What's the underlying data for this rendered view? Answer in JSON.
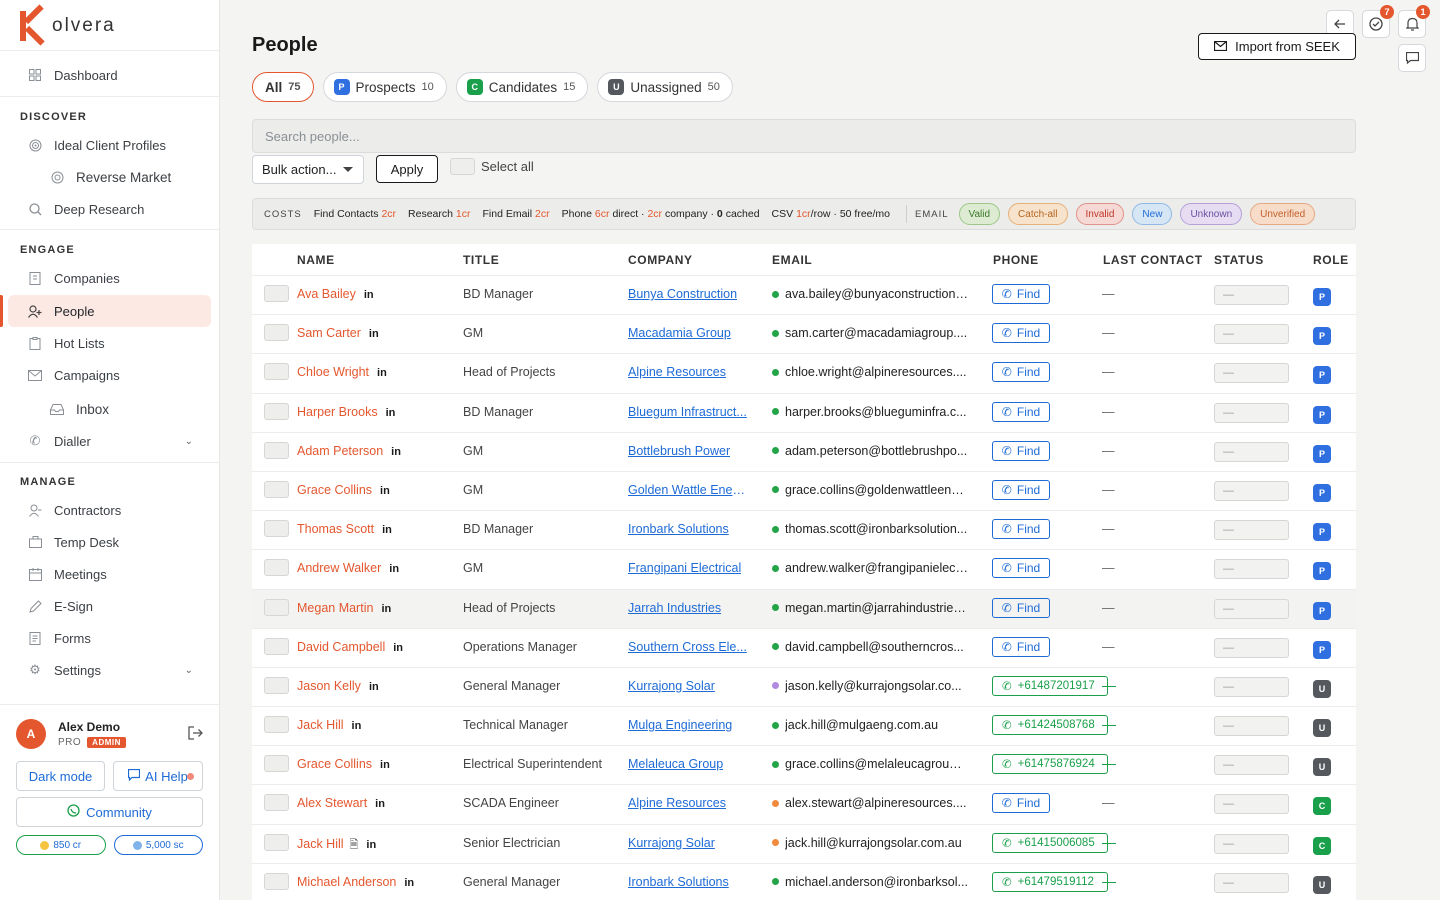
{
  "brand": {
    "name": "olvera",
    "accent": "#e4572e"
  },
  "nav": {
    "dashboard": "Dashboard",
    "discover_label": "DISCOVER",
    "ideal_client": "Ideal Client Profiles",
    "reverse_market": "Reverse Market",
    "deep_research": "Deep Research",
    "engage_label": "ENGAGE",
    "companies": "Companies",
    "people": "People",
    "hot_lists": "Hot Lists",
    "campaigns": "Campaigns",
    "inbox": "Inbox",
    "dialler": "Dialler",
    "manage_label": "MANAGE",
    "contractors": "Contractors",
    "temp_desk": "Temp Desk",
    "meetings": "Meetings",
    "esign": "E-Sign",
    "forms": "Forms",
    "settings": "Settings"
  },
  "user": {
    "initial": "A",
    "name": "Alex Demo",
    "tier": "PRO",
    "role_badge": "ADMIN",
    "dark_mode": "Dark mode",
    "ai_help": "AI Help",
    "community": "Community",
    "credits": "850 cr",
    "sc": "5,000 sc"
  },
  "header": {
    "title": "People",
    "import_btn": "Import from SEEK",
    "tasks_count": "7",
    "notif_count": "1"
  },
  "tabs": [
    {
      "label": "All",
      "count": "75"
    },
    {
      "badge": "P",
      "label": "Prospects",
      "count": "10"
    },
    {
      "badge": "C",
      "label": "Candidates",
      "count": "15"
    },
    {
      "badge": "U",
      "label": "Unassigned",
      "count": "50"
    }
  ],
  "toolbar": {
    "search_placeholder": "Search people...",
    "bulk": "Bulk action...",
    "apply": "Apply",
    "select_all": "Select all"
  },
  "costs": {
    "label": "COSTS",
    "find_contacts": "Find Contacts",
    "find_contacts_cr": "2cr",
    "research": "Research",
    "research_cr": "1cr",
    "find_email": "Find Email",
    "find_email_cr": "2cr",
    "phone": "Phone",
    "phone_direct_cr": "6cr",
    "phone_direct": "direct ·",
    "phone_company_cr": "2cr",
    "phone_company": "company ·",
    "phone_cached_cr": "0",
    "phone_cached": "cached",
    "csv": "CSV",
    "csv_cr": "1cr",
    "csv_rest": "/row · 50 free/mo",
    "email_label": "EMAIL",
    "pills": [
      {
        "label": "Valid",
        "color": "#3d7a2a",
        "bg": "#dcebd2",
        "border": "#9cc788"
      },
      {
        "label": "Catch-all",
        "color": "#b5651d",
        "bg": "#f7e3cc",
        "border": "#e5b079"
      },
      {
        "label": "Invalid",
        "color": "#c0392b",
        "bg": "#f6d8d4",
        "border": "#e0928a"
      },
      {
        "label": "New",
        "color": "#1e6bd6",
        "bg": "#d6e6f5",
        "border": "#8fb9e4"
      },
      {
        "label": "Unknown",
        "color": "#6b4fa0",
        "bg": "#e6ddf3",
        "border": "#b6a0d8"
      },
      {
        "label": "Unverified",
        "color": "#c0602b",
        "bg": "#f7dcc9",
        "border": "#e6a883"
      }
    ]
  },
  "table": {
    "columns": [
      "NAME",
      "TITLE",
      "COMPANY",
      "EMAIL",
      "PHONE",
      "LAST CONTACT",
      "STATUS",
      "ROLE"
    ],
    "find_label": "Find",
    "dash": "—",
    "li": "in",
    "rows": [
      {
        "name": "Ava Bailey",
        "title": "BD Manager",
        "company": "Bunya Construction",
        "email": "ava.bailey@bunyaconstruction....",
        "email_status": "#22a447",
        "phone": "",
        "role": "P"
      },
      {
        "name": "Sam Carter",
        "title": "GM",
        "company": "Macadamia Group",
        "email": "sam.carter@macadamiagroup....",
        "email_status": "#22a447",
        "phone": "",
        "role": "P"
      },
      {
        "name": "Chloe Wright",
        "title": "Head of Projects",
        "company": "Alpine Resources",
        "email": "chloe.wright@alpineresources....",
        "email_status": "#22a447",
        "phone": "",
        "role": "P"
      },
      {
        "name": "Harper Brooks",
        "title": "BD Manager",
        "company": "Bluegum Infrastruct...",
        "email": "harper.brooks@blueguminfra.c...",
        "email_status": "#22a447",
        "phone": "",
        "role": "P"
      },
      {
        "name": "Adam Peterson",
        "title": "GM",
        "company": "Bottlebrush Power",
        "email": "adam.peterson@bottlebrushpo...",
        "email_status": "#22a447",
        "phone": "",
        "role": "P"
      },
      {
        "name": "Grace Collins",
        "title": "GM",
        "company": "Golden Wattle Energy",
        "email": "grace.collins@goldenwattleene...",
        "email_status": "#22a447",
        "phone": "",
        "role": "P"
      },
      {
        "name": "Thomas Scott",
        "title": "BD Manager",
        "company": "Ironbark Solutions",
        "email": "thomas.scott@ironbarksolution...",
        "email_status": "#22a447",
        "phone": "",
        "role": "P"
      },
      {
        "name": "Andrew Walker",
        "title": "GM",
        "company": "Frangipani Electrical",
        "email": "andrew.walker@frangipanielect...",
        "email_status": "#22a447",
        "phone": "",
        "role": "P"
      },
      {
        "name": "Megan Martin",
        "title": "Head of Projects",
        "company": "Jarrah Industries",
        "email": "megan.martin@jarrahindustries...",
        "email_status": "#22a447",
        "phone": "",
        "role": "P"
      },
      {
        "name": "David Campbell",
        "title": "Operations Manager",
        "company": "Southern Cross Ele...",
        "email": "david.campbell@southerncros...",
        "email_status": "#22a447",
        "phone": "",
        "role": "P"
      },
      {
        "name": "Jason Kelly",
        "title": "General Manager",
        "company": "Kurrajong Solar",
        "email": "jason.kelly@kurrajongsolar.co...",
        "email_status": "#b08ae0",
        "phone": "+61487201917",
        "role": "U"
      },
      {
        "name": "Jack Hill",
        "title": "Technical Manager",
        "company": "Mulga Engineering",
        "email": "jack.hill@mulgaeng.com.au",
        "email_status": "#22a447",
        "phone": "+61424508768",
        "role": "U"
      },
      {
        "name": "Grace Collins",
        "title": "Electrical Superintendent",
        "company": "Melaleuca Group",
        "email": "grace.collins@melaleucagroup....",
        "email_status": "#22a447",
        "phone": "+61475876924",
        "role": "U"
      },
      {
        "name": "Alex Stewart",
        "title": "SCADA Engineer",
        "company": "Alpine Resources",
        "email": "alex.stewart@alpineresources....",
        "email_status": "#f08a3c",
        "phone": "",
        "role": "C"
      },
      {
        "name": "Jack Hill",
        "title": "Senior Electrician",
        "company": "Kurrajong Solar",
        "email": "jack.hill@kurrajongsolar.com.au",
        "email_status": "#f08a3c",
        "phone": "+61415006085",
        "role": "C",
        "doc": true
      },
      {
        "name": "Michael Anderson",
        "title": "General Manager",
        "company": "Ironbark Solutions",
        "email": "michael.anderson@ironbarksol...",
        "email_status": "#22a447",
        "phone": "+61479519112",
        "role": "U"
      }
    ]
  },
  "role_colors": {
    "P": "#2f6fe0",
    "C": "#1aa04a",
    "U": "#55585c"
  }
}
